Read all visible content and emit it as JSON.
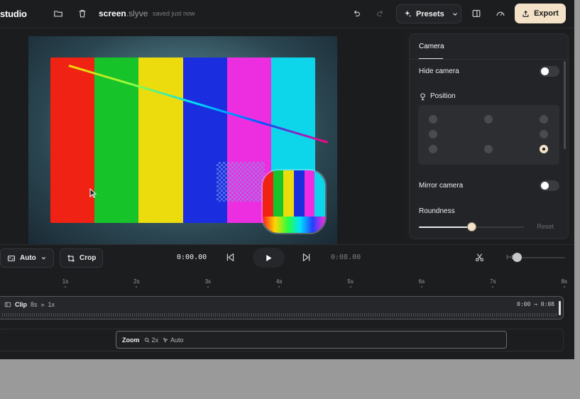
{
  "topbar": {
    "brand": "studio",
    "project_name": "screen",
    "project_ext": ".slyve",
    "saved_status": "saved just now",
    "presets_label": "Presets",
    "export_label": "Export"
  },
  "preview": {
    "color_bars": [
      "#ef2214",
      "#16c42a",
      "#ecdc0e",
      "#1a2ee0",
      "#ec2ee0",
      "#0ed6ea"
    ]
  },
  "camera_panel": {
    "tab_label": "Camera",
    "hide_camera_label": "Hide camera",
    "hide_camera_on": false,
    "position_label": "Position",
    "position_selected": "bottom-right",
    "mirror_camera_label": "Mirror camera",
    "mirror_camera_on": false,
    "roundness_label": "Roundness",
    "roundness_value": 0.5,
    "reset_label": "Reset"
  },
  "controls": {
    "aspect_label": "Auto",
    "crop_label": "Crop",
    "current_time": "0:00.00",
    "total_time": "0:08.00"
  },
  "timeline": {
    "ticks": [
      "1s",
      "2s",
      "3s",
      "4s",
      "5s",
      "6s",
      "7s",
      "8s"
    ],
    "clip": {
      "name": "Clip",
      "duration": "8s",
      "speed": "1x",
      "range": "0:00 → 0:08"
    },
    "zoom": {
      "name": "Zoom",
      "level": "2x",
      "mode": "Auto"
    }
  },
  "colors": {
    "accent": "#f3e1c8",
    "background": "#1c1d1f"
  }
}
